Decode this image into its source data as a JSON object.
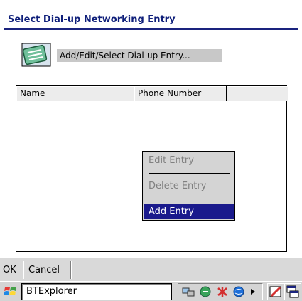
{
  "dialog": {
    "title": "Select Dial-up Networking Entry",
    "header_label": "Add/Edit/Select Dial-up Entry..."
  },
  "list": {
    "columns": [
      "Name",
      "Phone Number",
      ""
    ],
    "rows": []
  },
  "context_menu": {
    "items": [
      {
        "label": "Edit Entry",
        "enabled": false
      },
      {
        "label": "Delete Entry",
        "enabled": false
      },
      {
        "label": "Add Entry",
        "enabled": true,
        "selected": true
      }
    ]
  },
  "menubar": {
    "ok_label": "OK",
    "cancel_label": "Cancel"
  },
  "taskbar": {
    "active_task": "BTExplorer",
    "icons": [
      "windows-start-icon",
      "network-icon",
      "connection-icon",
      "bluetooth-icon",
      "arrow-right-icon",
      "pen-input-icon",
      "window-switch-icon"
    ]
  },
  "colors": {
    "title_text": "#0f1f7a",
    "selection": "#1a1a8c",
    "menubar": "#d9d9d9"
  }
}
